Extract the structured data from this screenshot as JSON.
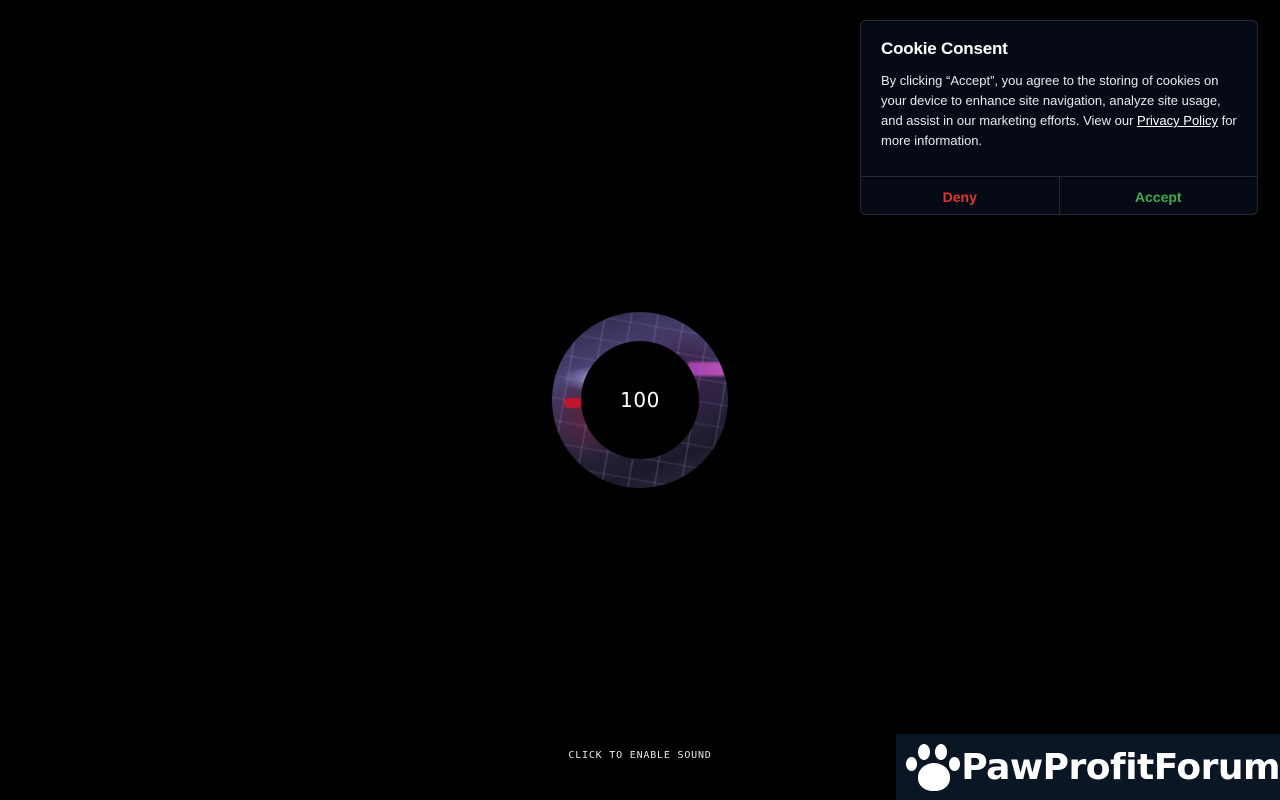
{
  "cookie_consent": {
    "title": "Cookie Consent",
    "body_before_link": "By clicking “Accept”, you agree to the storing of cookies on your device to enhance site navigation, analyze site usage, and assist in our marketing efforts. View our ",
    "link_label": "Privacy Policy",
    "body_after_link": " for more information.",
    "deny_label": "Deny",
    "accept_label": "Accept",
    "colors": {
      "deny": "#e0392b",
      "accept": "#3fae4a"
    }
  },
  "loader": {
    "value": "100"
  },
  "sound_prompt": {
    "label": "CLICK TO ENABLE SOUND"
  },
  "watermark": {
    "icon": "paw-icon",
    "text": "PawProfitForum"
  }
}
